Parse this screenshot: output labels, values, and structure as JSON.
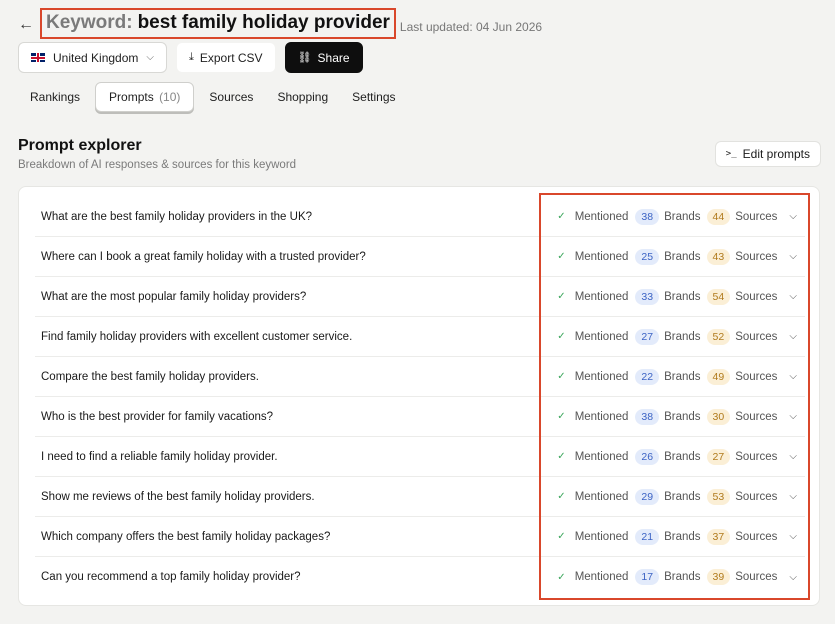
{
  "header": {
    "back_icon": "arrow-left-icon",
    "title_prefix": "Keyword:",
    "title_keyword": "best family holiday provider",
    "last_updated": "Last updated: 04 Jun 2026"
  },
  "toolbar": {
    "country": "United Kingdom",
    "export_label": "Export CSV",
    "share_label": "Share"
  },
  "tabs": [
    {
      "label": "Rankings"
    },
    {
      "label": "Prompts",
      "count": "(10)",
      "active": true
    },
    {
      "label": "Sources"
    },
    {
      "label": "Shopping"
    },
    {
      "label": "Settings"
    }
  ],
  "section": {
    "title": "Prompt explorer",
    "subtitle": "Breakdown of AI responses & sources for this keyword",
    "edit_label": "Edit prompts"
  },
  "labels": {
    "mentioned": "Mentioned",
    "brands": "Brands",
    "sources": "Sources"
  },
  "prompts": [
    {
      "text": "What are the best family holiday providers in the UK?",
      "brands": "38",
      "sources": "44"
    },
    {
      "text": "Where can I book a great family holiday with a trusted provider?",
      "brands": "25",
      "sources": "43"
    },
    {
      "text": "What are the most popular family holiday providers?",
      "brands": "33",
      "sources": "54"
    },
    {
      "text": "Find family holiday providers with excellent customer service.",
      "brands": "27",
      "sources": "52"
    },
    {
      "text": "Compare the best family holiday providers.",
      "brands": "22",
      "sources": "49"
    },
    {
      "text": "Who is the best provider for family vacations?",
      "brands": "38",
      "sources": "30"
    },
    {
      "text": "I need to find a reliable family holiday provider.",
      "brands": "26",
      "sources": "27"
    },
    {
      "text": "Show me reviews of the best family holiday providers.",
      "brands": "29",
      "sources": "53"
    },
    {
      "text": "Which company offers the best family holiday packages?",
      "brands": "21",
      "sources": "37"
    },
    {
      "text": "Can you recommend a top family holiday provider?",
      "brands": "17",
      "sources": "39"
    }
  ],
  "colors": {
    "highlight": "#d9472b",
    "brands_pill": "#e3ebfb",
    "sources_pill": "#fbefd6",
    "mentioned_check": "#3aa55a"
  }
}
